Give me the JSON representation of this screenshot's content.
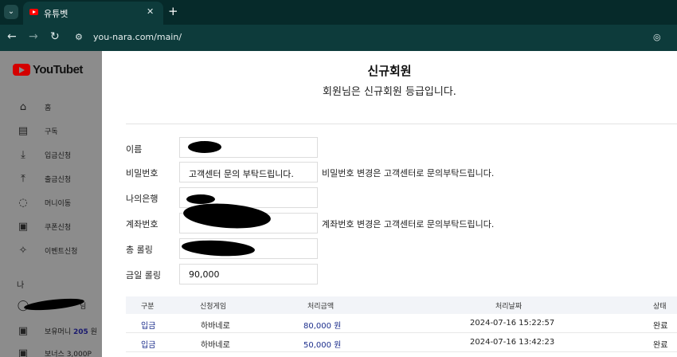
{
  "browser": {
    "tab_title": "유튜벳",
    "tab_close": "✕",
    "new_tab": "+",
    "url": "you-nara.com/main/"
  },
  "sidebar": {
    "logo_text": "YouTubet",
    "items": [
      {
        "label": "홈",
        "icon": "home-icon"
      },
      {
        "label": "구독",
        "icon": "subscriptions-icon"
      },
      {
        "label": "입금신청",
        "icon": "download-icon"
      },
      {
        "label": "출금신청",
        "icon": "upload-icon"
      },
      {
        "label": "머니이동",
        "icon": "transfer-icon"
      },
      {
        "label": "쿠폰신청",
        "icon": "coupon-icon"
      },
      {
        "label": "이벤트신청",
        "icon": "party-icon"
      }
    ],
    "section_label": "나",
    "user_suffix": "님",
    "money_label_prefix": "보유머니",
    "money_value": "205",
    "money_unit": "원",
    "bonus_label": "보너스 3,000P"
  },
  "main": {
    "title": "신규회원",
    "subtitle": "회원님은 신규회원 등급입니다.",
    "fields": [
      {
        "label": "이름",
        "value": ""
      },
      {
        "label": "비밀번호",
        "value": "고객센터 문의 부탁드립니다.",
        "note": "비밀번호 변경은 고객센터로 문의부탁드립니다."
      },
      {
        "label": "나의은행",
        "value": ""
      },
      {
        "label": "계좌번호",
        "value": "",
        "note": "계좌번호 변경은 고객센터로 문의부탁드립니다."
      },
      {
        "label": "총 롤링",
        "value": ""
      },
      {
        "label": "금일 롤링",
        "value": "90,000"
      }
    ]
  },
  "table": {
    "headers": [
      "구분",
      "신청게임",
      "처리금액",
      "처리날짜",
      "상태"
    ],
    "rows": [
      {
        "type": "입금",
        "game": "하바네로",
        "amount": "80,000 원",
        "date": "2024-07-16 15:22:57",
        "status": "완료"
      },
      {
        "type": "입금",
        "game": "하바네로",
        "amount": "50,000 원",
        "date": "2024-07-16 13:42:23",
        "status": "완료"
      }
    ]
  }
}
